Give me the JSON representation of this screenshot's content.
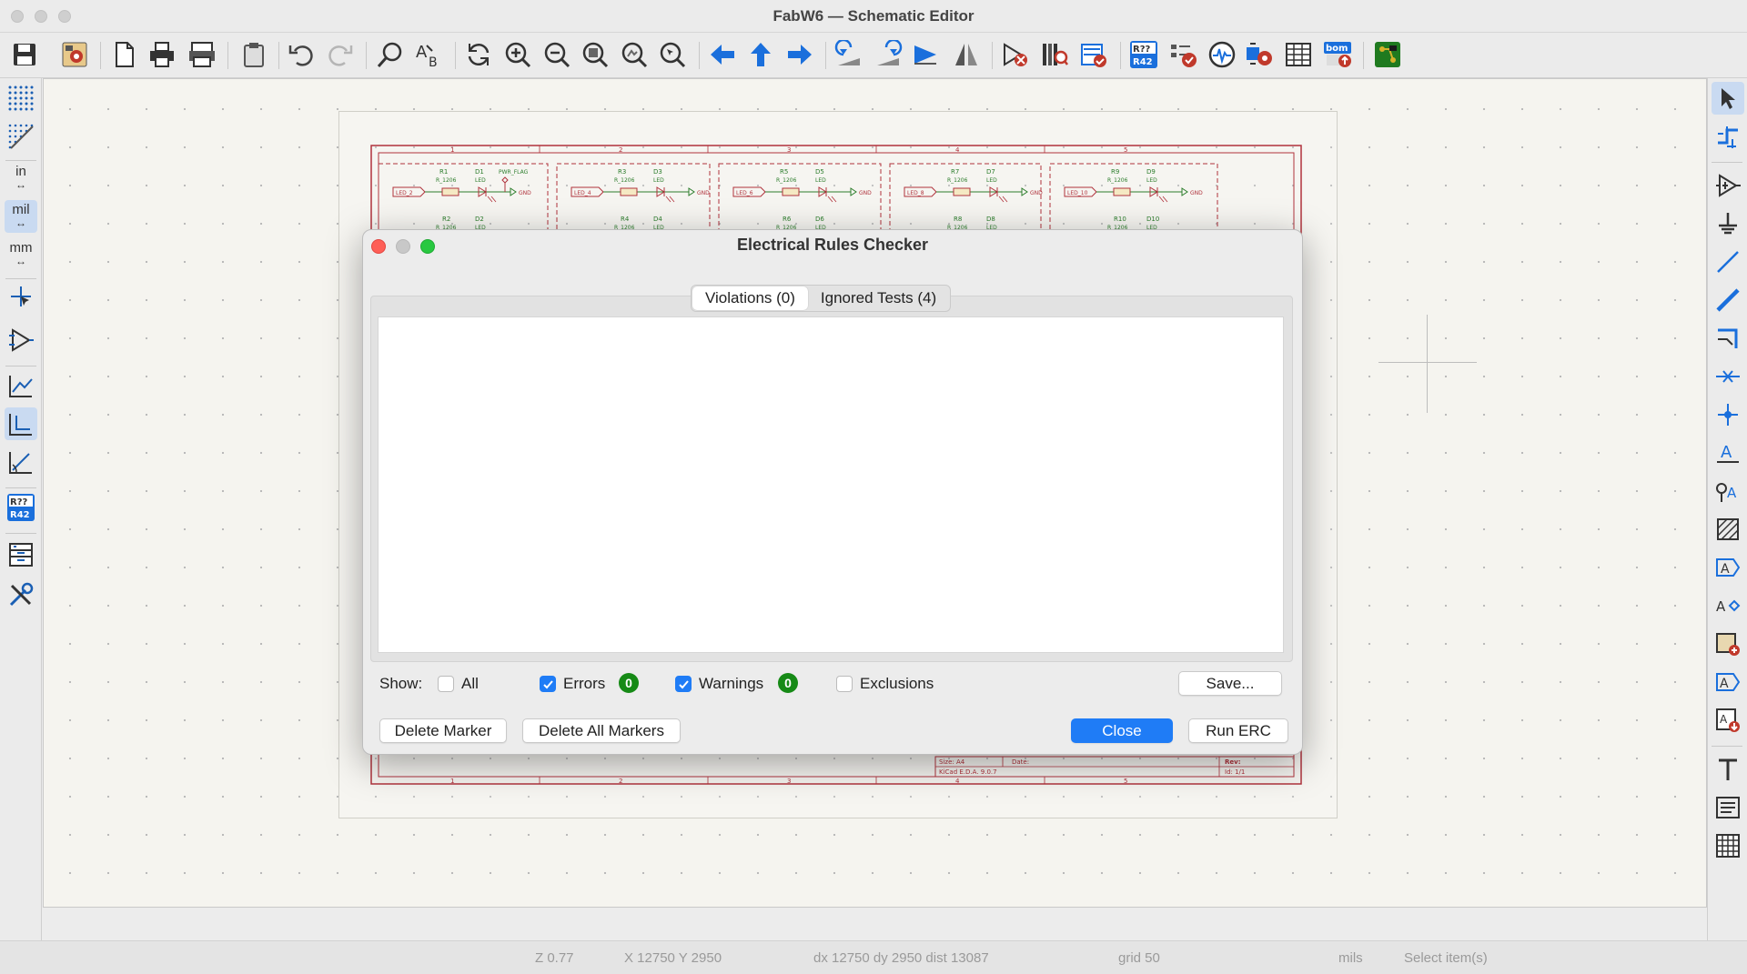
{
  "window": {
    "title": "FabW6 — Schematic Editor"
  },
  "left_toolbar": {
    "units": {
      "inch": "in",
      "mil": "mil",
      "mm": "mm"
    },
    "annotate_label_top": "R??",
    "annotate_label_bottom": "R42"
  },
  "top_toolbar": {
    "annotate_label_top": "R??",
    "annotate_label_bottom": "R42",
    "bom_label": "bom"
  },
  "schematic": {
    "sheet_columns": [
      "1",
      "2",
      "3",
      "4",
      "5"
    ],
    "blocks": [
      {
        "net": "LED_2",
        "resistor": "R1",
        "resistor_value": "R_1206",
        "diode": "D1",
        "diode_value": "LED",
        "flag": "PWR_FLAG",
        "ground": "GND",
        "resistor2": "R2",
        "diode2": "D2"
      },
      {
        "net": "LED_4",
        "resistor": "R3",
        "resistor_value": "R_1206",
        "diode": "D3",
        "diode_value": "LED",
        "flag": "",
        "ground": "GND",
        "resistor2": "R4",
        "diode2": "D4"
      },
      {
        "net": "LED_6",
        "resistor": "R5",
        "resistor_value": "R_1206",
        "diode": "D5",
        "diode_value": "LED",
        "flag": "",
        "ground": "GND",
        "resistor2": "R6",
        "diode2": "D6"
      },
      {
        "net": "LED_8",
        "resistor": "R7",
        "resistor_value": "R_1206",
        "diode": "D7",
        "diode_value": "LED",
        "flag": "",
        "ground": "GND",
        "resistor2": "R8",
        "diode2": "D8"
      },
      {
        "net": "LED_10",
        "resistor": "R9",
        "resistor_value": "R_1206",
        "diode": "D9",
        "diode_value": "LED",
        "flag": "",
        "ground": "GND",
        "resistor2": "R10",
        "diode2": "D10"
      }
    ],
    "title_block": {
      "size": "Size: A4",
      "date": "Date:",
      "tool": "KiCad E.D.A. 9.0.7",
      "rev": "Rev:",
      "id": "Id: 1/1"
    }
  },
  "dialog": {
    "title": "Electrical Rules Checker",
    "tabs": [
      {
        "label": "Violations (0)",
        "selected": true
      },
      {
        "label": "Ignored Tests (4)",
        "selected": false
      }
    ],
    "show_label": "Show:",
    "filters": {
      "all": {
        "label": "All",
        "checked": false
      },
      "errors": {
        "label": "Errors",
        "checked": true,
        "count": "0"
      },
      "warnings": {
        "label": "Warnings",
        "checked": true,
        "count": "0"
      },
      "exclusions": {
        "label": "Exclusions",
        "checked": false
      }
    },
    "buttons": {
      "save": "Save...",
      "delete_marker": "Delete Marker",
      "delete_all_markers": "Delete All Markers",
      "close": "Close",
      "run_erc": "Run ERC"
    },
    "colors": {
      "primary": "#1f7cf6",
      "badge": "#168a16",
      "close_dot": "#fe5f57",
      "minimize_dot": "#c8c8c8",
      "zoom_dot": "#28c840"
    }
  },
  "statusbar": {
    "zoom": "Z 0.77",
    "position": "X 12750  Y 2950",
    "delta": "dx 12750  dy 2950  dist 13087",
    "grid": "grid 50",
    "units": "mils",
    "message": "Select item(s)"
  },
  "accent": {
    "toolbar_blue": "#1a6fdc",
    "schematic_red": "#b0323c",
    "schematic_green": "#2c7d2c"
  }
}
